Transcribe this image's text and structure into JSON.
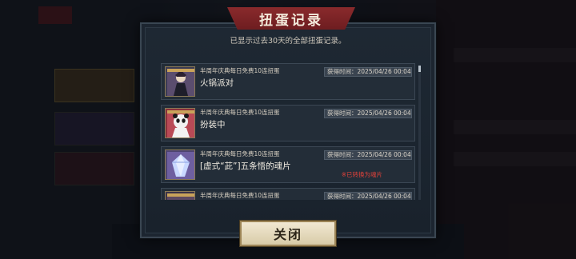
{
  "dialog": {
    "title": "扭蛋记录",
    "subtitle": "已显示过去30天的全部扭蛋记录。",
    "close_label": "关闭"
  },
  "records": [
    {
      "source": "半周年庆典每日免费10连扭蛋",
      "item": "火锅派对",
      "time": "获得时间：2025/04/26 00:04",
      "note": "",
      "icon": "character-card-thumb"
    },
    {
      "source": "半周年庆典每日免费10连扭蛋",
      "item": "扮装中",
      "time": "获得时间：2025/04/26 00:04",
      "note": "",
      "icon": "panda-character-card-thumb"
    },
    {
      "source": "半周年庆典每日免费10连扭蛋",
      "item": "[虚式“茈”]五条悟的魂片",
      "time": "获得时间：2025/04/26 00:04",
      "note": "※已转换为魂片",
      "icon": "soul-shard-crystal-thumb"
    },
    {
      "source": "半周年庆典每日免费10连扭蛋",
      "item": "",
      "time": "获得时间：2025/04/26 00:04",
      "note": "",
      "icon": "character-card-thumb"
    }
  ],
  "colors": {
    "title_banner": "#7a2326",
    "note_red": "#e0413a",
    "panel": "#1c2530",
    "close_button": "#e6dcc1"
  }
}
